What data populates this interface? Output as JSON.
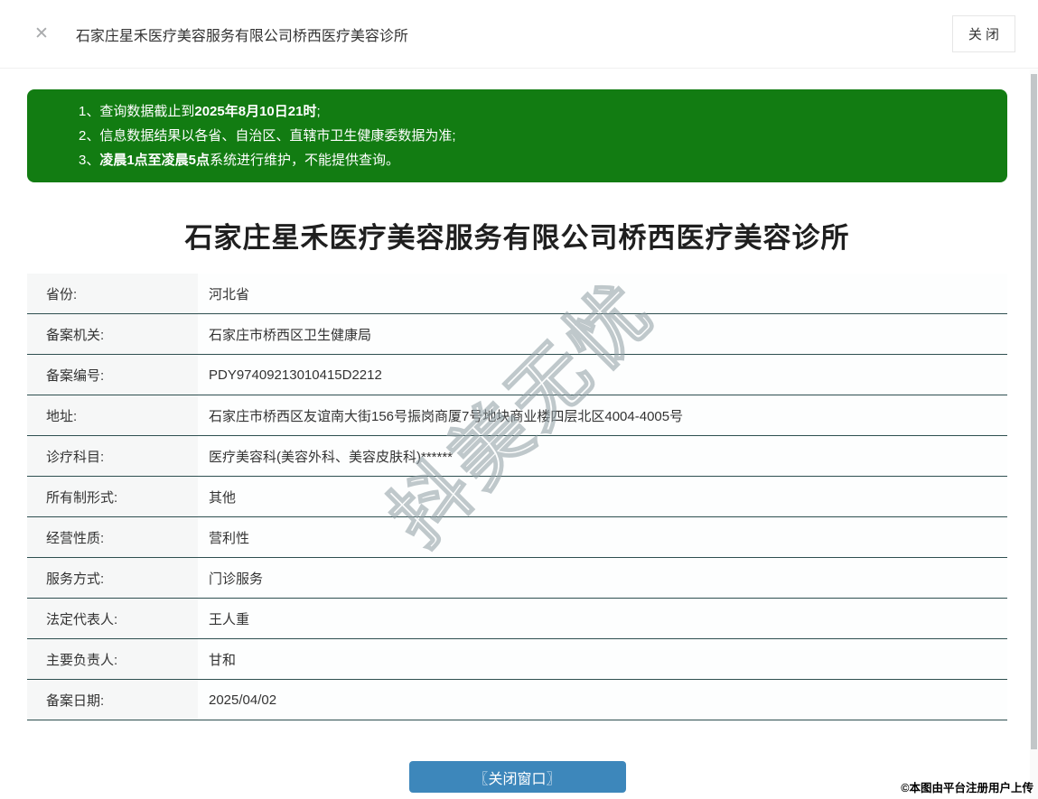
{
  "header": {
    "close_icon": "✕",
    "title": "石家庄星禾医疗美容服务有限公司桥西医疗美容诊所",
    "close_button": "关 闭"
  },
  "notice": {
    "lines": [
      {
        "num": "1、",
        "pre": "查询数据截止到",
        "bold": "2025年8月10日21时",
        "post": ";"
      },
      {
        "num": "2、",
        "pre": "信息数据结果以各省、自治区、直辖市卫生健康委数据为准;",
        "bold": "",
        "post": ""
      },
      {
        "num": "3、",
        "pre": "",
        "bold": "凌晨1点至凌晨5点",
        "post": "系统进行维护，不能提供查询。"
      }
    ]
  },
  "main": {
    "title": "石家庄星禾医疗美容服务有限公司桥西医疗美容诊所",
    "close_window_button": "〖关闭窗口〗"
  },
  "table": {
    "rows": [
      {
        "label": "省份:",
        "value": "河北省"
      },
      {
        "label": "备案机关:",
        "value": "石家庄市桥西区卫生健康局"
      },
      {
        "label": "备案编号:",
        "value": "PDY97409213010415D2212"
      },
      {
        "label": "地址:",
        "value": "石家庄市桥西区友谊南大街156号振岗商厦7号地块商业楼四层北区4004-4005号"
      },
      {
        "label": "诊疗科目:",
        "value": "医疗美容科(美容外科、美容皮肤科)******"
      },
      {
        "label": "所有制形式:",
        "value": "其他"
      },
      {
        "label": "经营性质:",
        "value": "营利性"
      },
      {
        "label": "服务方式:",
        "value": "门诊服务"
      },
      {
        "label": "法定代表人:",
        "value": "王人重"
      },
      {
        "label": "主要负责人:",
        "value": "甘和"
      },
      {
        "label": "备案日期:",
        "value": "2025/04/02"
      }
    ]
  },
  "watermark": {
    "text": "抖美无忧"
  },
  "footer": {
    "copyright": "©本图由平台注册用户上传"
  },
  "colors": {
    "notice_green": "#127c12",
    "button_blue": "#3d87bb",
    "row_border": "#2e4f50",
    "label_bg": "#f6f7f7"
  }
}
